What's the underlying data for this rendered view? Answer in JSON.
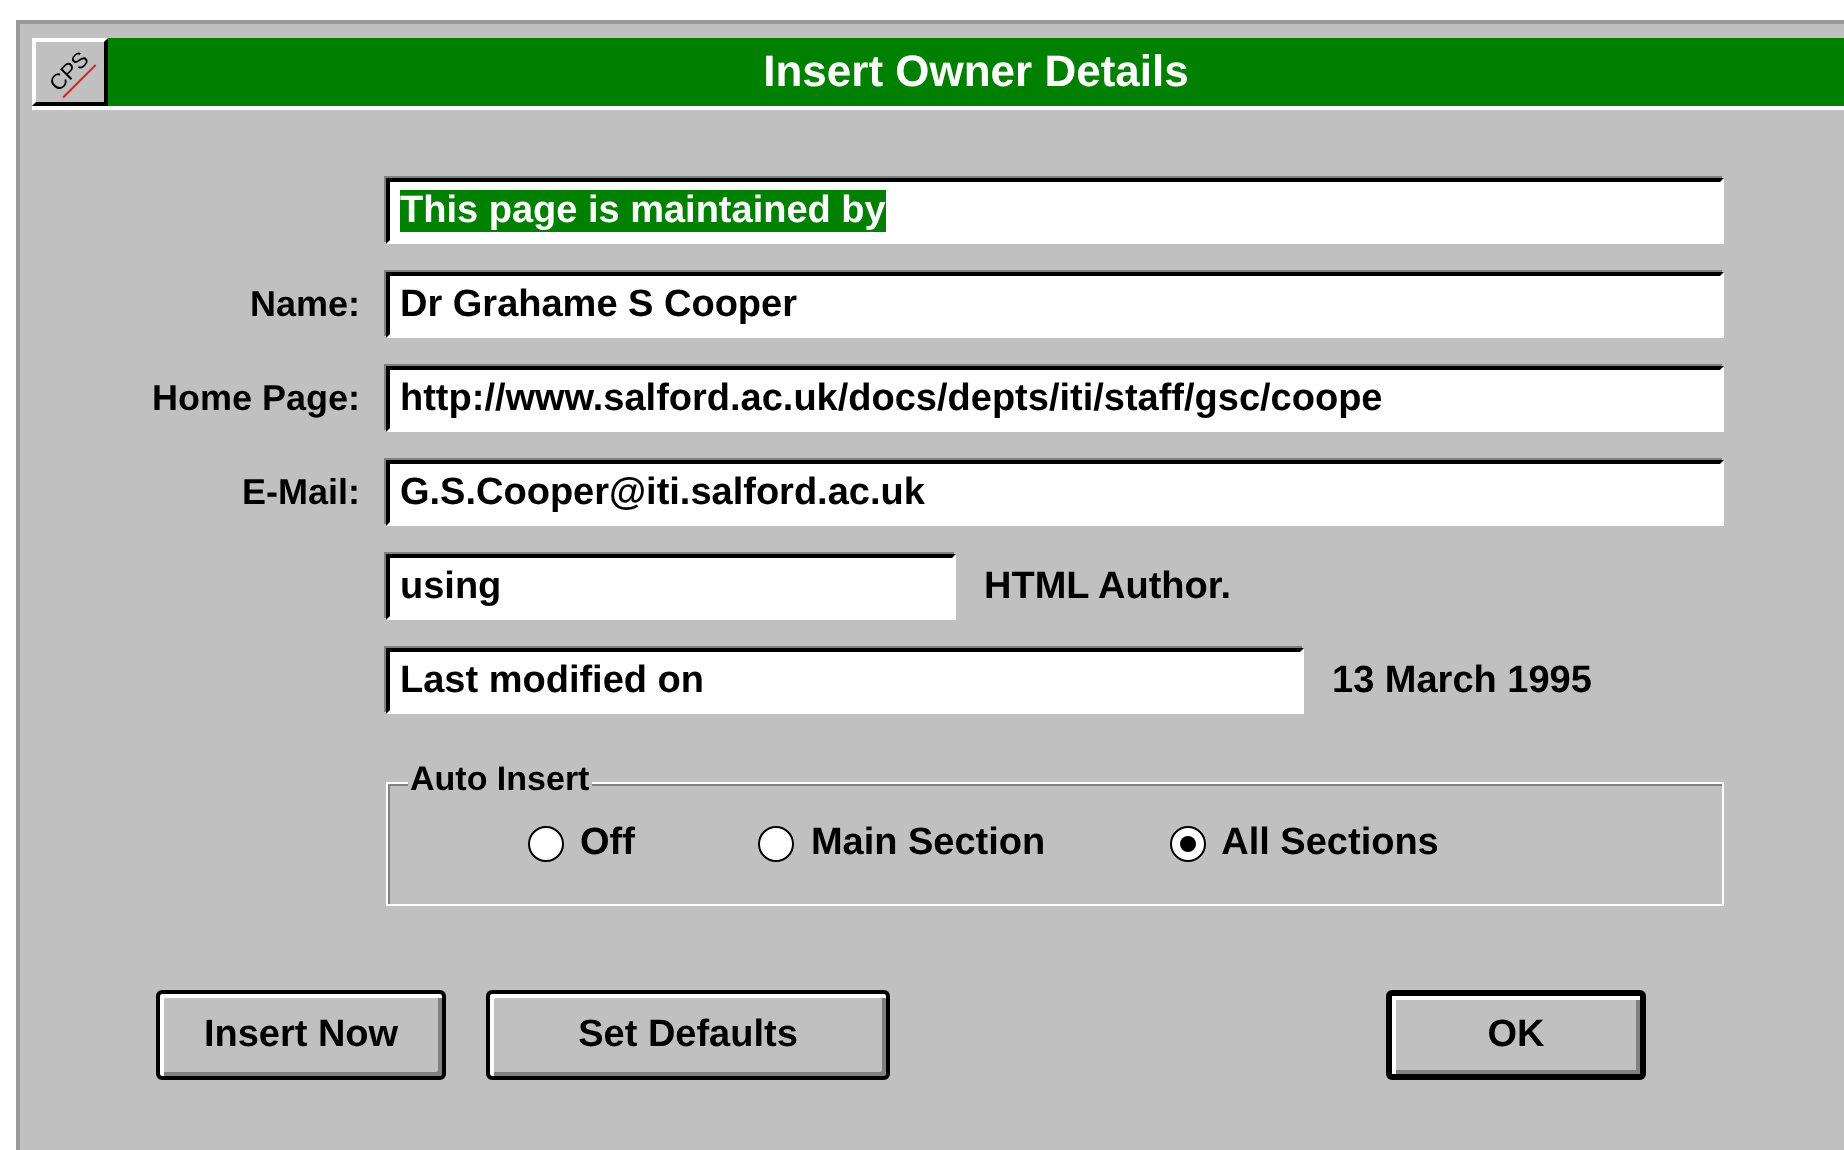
{
  "window": {
    "title": "Insert Owner Details",
    "icon_text": "CPS"
  },
  "header_field": {
    "value": "This page is maintained by",
    "highlighted": true
  },
  "fields": [
    {
      "label": "Name:",
      "value": "Dr Grahame S Cooper"
    },
    {
      "label": "Home Page:",
      "value": "http://www.salford.ac.uk/docs/depts/iti/staff/gsc/coope"
    },
    {
      "label": "E-Mail:",
      "value": "G.S.Cooper@iti.salford.ac.uk"
    }
  ],
  "using_field": {
    "value": "using",
    "suffix": "HTML Author."
  },
  "modified_field": {
    "value": "Last modified on",
    "suffix": "13 March 1995"
  },
  "auto_insert": {
    "title": "Auto Insert",
    "options": [
      {
        "label": "Off",
        "selected": false
      },
      {
        "label": "Main Section",
        "selected": false
      },
      {
        "label": "All Sections",
        "selected": true
      }
    ]
  },
  "buttons": [
    {
      "label": "Insert Now",
      "default": false
    },
    {
      "label": "Set Defaults",
      "default": false
    },
    {
      "label": "OK",
      "default": true
    }
  ]
}
